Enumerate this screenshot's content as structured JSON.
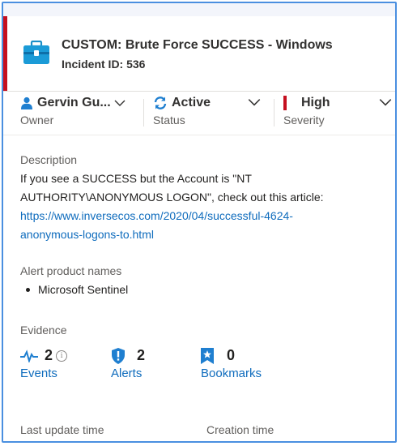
{
  "incident": {
    "title": "CUSTOM: Brute Force SUCCESS - Windows",
    "id_text": "Incident ID: 536",
    "severity_color": "#c50f1f"
  },
  "owner": {
    "value": "Gervin Gu...",
    "label": "Owner"
  },
  "status": {
    "value": "Active",
    "label": "Status"
  },
  "severity": {
    "value": "High",
    "label": "Severity"
  },
  "description": {
    "label": "Description",
    "line1": "If you see a SUCCESS but the Account is \"NT",
    "line2": "AUTHORITY\\ANONYMOUS LOGON\", check out this article:",
    "link_line1": "https://www.inversecos.com/2020/04/successful-4624-",
    "link_line2": "anonymous-logons-to.html"
  },
  "alert_products": {
    "label": "Alert product names",
    "items": [
      "Microsoft Sentinel"
    ]
  },
  "evidence": {
    "label": "Evidence",
    "events": {
      "count": "2",
      "label": "Events"
    },
    "alerts": {
      "count": "2",
      "label": "Alerts"
    },
    "bookmarks": {
      "count": "0",
      "label": "Bookmarks"
    }
  },
  "footer": {
    "last_update_label": "Last update time",
    "creation_label": "Creation time"
  },
  "colors": {
    "accent": "#0f6cbd",
    "severity_bar": "#c50f1f"
  }
}
